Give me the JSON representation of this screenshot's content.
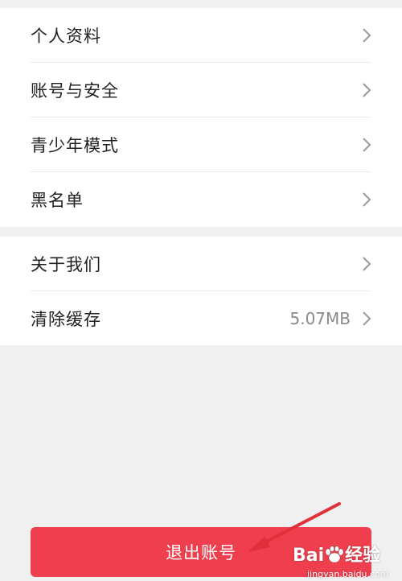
{
  "colors": {
    "background": "#f0f0f0",
    "card": "#ffffff",
    "divider": "#ececec",
    "text": "#222222",
    "secondary_text": "#8a8a8a",
    "chevron": "#9a9a9a",
    "logout_bg": "#ef3f4f",
    "annotation_arrow": "#e0303a"
  },
  "settings": {
    "group1": [
      {
        "label": "个人资料",
        "icon": "chevron-right-icon"
      },
      {
        "label": "账号与安全",
        "icon": "chevron-right-icon"
      },
      {
        "label": "青少年模式",
        "icon": "chevron-right-icon"
      },
      {
        "label": "黑名单",
        "icon": "chevron-right-icon"
      }
    ],
    "group2": [
      {
        "label": "关于我们",
        "icon": "chevron-right-icon"
      },
      {
        "label": "清除缓存",
        "value": "5.07MB",
        "icon": "chevron-right-icon"
      }
    ]
  },
  "logout": {
    "label": "退出账号"
  },
  "watermark": {
    "brand_left": "Bai",
    "brand_right": "经验",
    "url": "jingyan.baidu.com"
  }
}
